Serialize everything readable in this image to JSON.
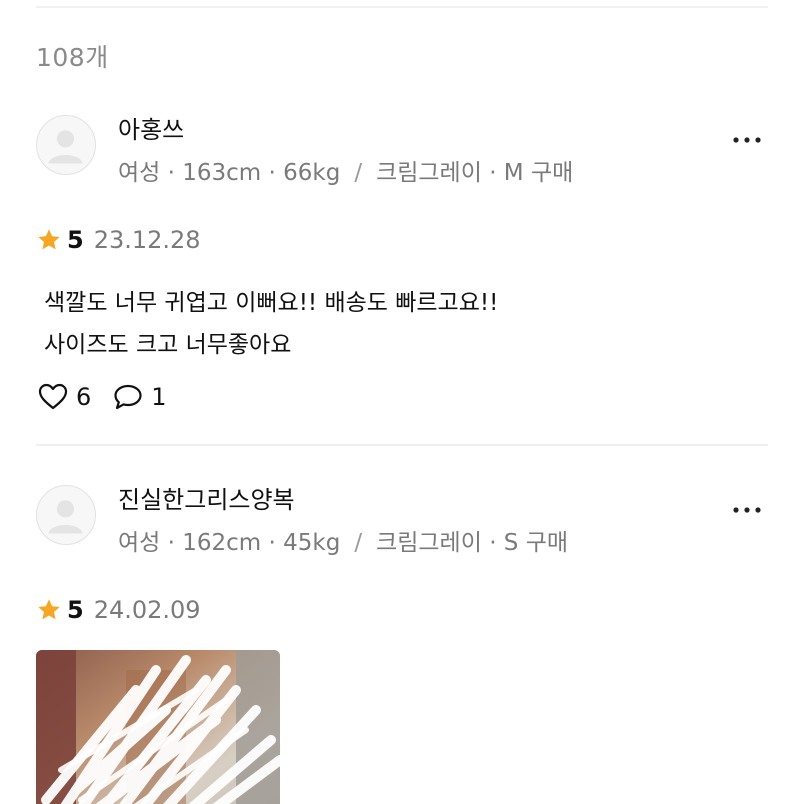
{
  "header": {
    "review_count": "108개"
  },
  "reviews": [
    {
      "username": "아홍쓰",
      "profile": "여성 · 163cm · 66kg",
      "option": "크림그레이 · M 구매",
      "rating": "5",
      "date": "23.12.28",
      "body_line1": "색깔도 너무 귀엽고 이뻐요!! 배송도 빠르고요!!",
      "body_line2": "사이즈도 크고 너무좋아요",
      "likes": "6",
      "comments": "1"
    },
    {
      "username": "진실한그리스양복",
      "profile": "여성 · 162cm · 45kg",
      "option": "크림그레이 · S 구매",
      "rating": "5",
      "date": "24.02.09"
    }
  ],
  "separator": "/",
  "colors": {
    "star": "#f5a623",
    "meta_text": "#7a7a7a",
    "divider": "#efefef"
  },
  "icons": {
    "avatar": "default-avatar-icon",
    "more": "more-horizontal-icon",
    "star": "star-icon",
    "like": "heart-outline-icon",
    "comment": "speech-bubble-icon"
  }
}
